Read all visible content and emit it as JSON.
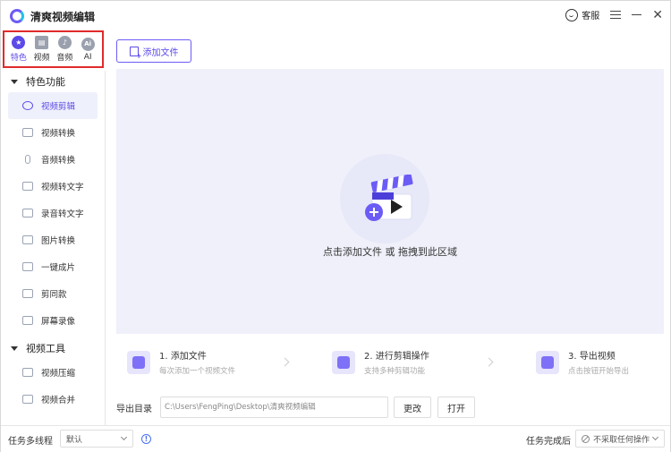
{
  "app": {
    "title": "清爽视频编辑"
  },
  "titlebar": {
    "service_label": "客服"
  },
  "categories": [
    {
      "label": "特色",
      "icon": "star-icon",
      "glyph": "★",
      "active": true
    },
    {
      "label": "视频",
      "icon": "film-icon",
      "glyph": "▤",
      "active": false
    },
    {
      "label": "音频",
      "icon": "music-icon",
      "glyph": "♪",
      "active": false
    },
    {
      "label": "AI",
      "icon": "ai-icon",
      "glyph": "Ai",
      "active": false
    }
  ],
  "sidebar": {
    "sections": [
      {
        "title": "特色功能",
        "items": [
          {
            "label": "视频剪辑",
            "icon": "film-reel-icon",
            "active": true
          },
          {
            "label": "视频转换",
            "icon": "video-convert-icon",
            "active": false
          },
          {
            "label": "音频转换",
            "icon": "microphone-icon",
            "active": false
          },
          {
            "label": "视频转文字",
            "icon": "video-to-text-icon",
            "active": false
          },
          {
            "label": "录音转文字",
            "icon": "audio-to-text-icon",
            "active": false
          },
          {
            "label": "图片转换",
            "icon": "image-icon",
            "active": false
          },
          {
            "label": "一键成片",
            "icon": "oneclick-video-icon",
            "active": false
          },
          {
            "label": "剪同款",
            "icon": "template-icon",
            "active": false
          },
          {
            "label": "屏幕录像",
            "icon": "screen-record-icon",
            "active": false
          }
        ]
      },
      {
        "title": "视频工具",
        "items": [
          {
            "label": "视频压缩",
            "icon": "compress-icon",
            "active": false
          },
          {
            "label": "视频合并",
            "icon": "merge-icon",
            "active": false
          }
        ]
      }
    ]
  },
  "toolbar": {
    "add_file_label": "添加文件"
  },
  "dropzone": {
    "hint": "点击添加文件 或 拖拽到此区域"
  },
  "steps": [
    {
      "title": "1. 添加文件",
      "subtitle": "每次添加一个视频文件"
    },
    {
      "title": "2. 进行剪辑操作",
      "subtitle": "支持多种剪辑功能"
    },
    {
      "title": "3. 导出视频",
      "subtitle": "点击按钮开始导出"
    }
  ],
  "export": {
    "label": "导出目录",
    "path": "C:\\Users\\FengPing\\Desktop\\清爽视频编辑",
    "change_label": "更改",
    "open_label": "打开"
  },
  "statusbar": {
    "threads_label": "任务多线程",
    "threads_value": "默认",
    "after_label": "任务完成后",
    "after_value": "不采取任何操作"
  },
  "colors": {
    "accent": "#5b49e8",
    "highlight_border": "#e12b2b",
    "dropzone_bg": "#eff0fa"
  }
}
